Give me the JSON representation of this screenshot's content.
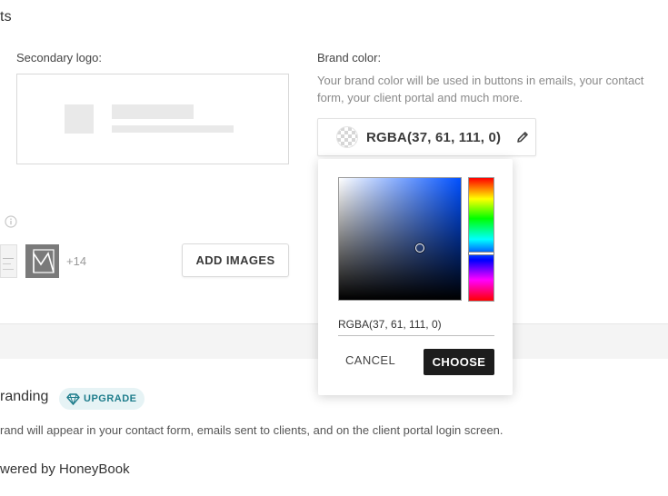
{
  "top_section": {
    "title_fragment": "ts"
  },
  "secondary_logo": {
    "label": "Secondary logo:"
  },
  "brand_color": {
    "label": "Brand color:",
    "hint_line1": "Your brand color will be used in buttons in emails, your contact",
    "hint_line2": "form, your client portal and much more.",
    "value": "RGBA(37, 61, 111, 0)",
    "edit_icon": "pencil-icon",
    "swatch_icon": "transparent-checker-icon"
  },
  "images": {
    "info_icon": "info-icon",
    "more_count": "+14",
    "add_button": "ADD IMAGES"
  },
  "color_picker": {
    "input_value": "RGBA(37, 61, 111, 0)",
    "cancel_label": "CANCEL",
    "choose_label": "CHOOSE",
    "hue_color": "#0050ff"
  },
  "branding": {
    "title_fragment": "randing",
    "upgrade_label": "UPGRADE",
    "upgrade_icon": "diamond-icon",
    "description": "rand will appear in your contact form, emails sent to clients, and on the client portal login screen.",
    "powered_by": "wered by HoneyBook"
  },
  "colors": {
    "accent_teal": "#1f7d8c",
    "upgrade_bg": "#e6f3f5",
    "choose_bg": "#1d1d1d"
  }
}
